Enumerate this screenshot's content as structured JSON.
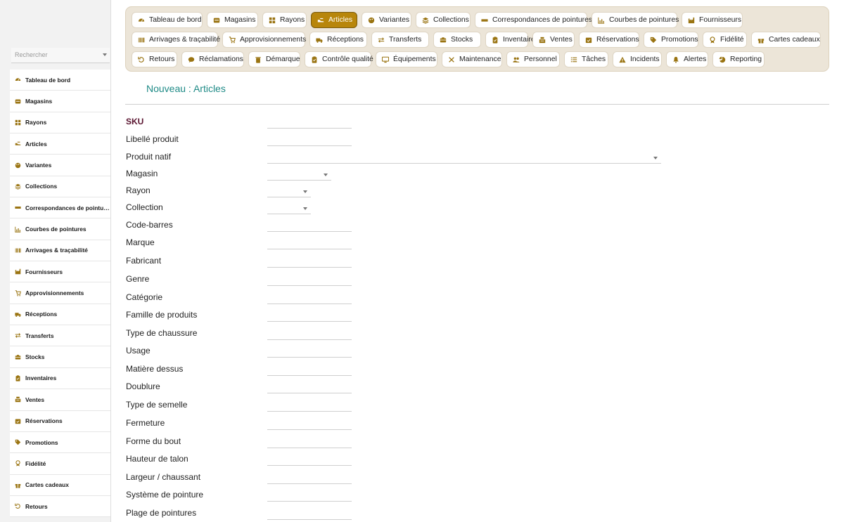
{
  "sidebar": {
    "search_placeholder": "Rechercher",
    "items": [
      {
        "label": "Tableau de bord",
        "icon": "dashboard-icon"
      },
      {
        "label": "Magasins",
        "icon": "store-icon"
      },
      {
        "label": "Rayons",
        "icon": "grid-icon"
      },
      {
        "label": "Articles",
        "icon": "shoe-icon"
      },
      {
        "label": "Variantes",
        "icon": "palette-icon"
      },
      {
        "label": "Collections",
        "icon": "layers-icon"
      },
      {
        "label": "Correspondances de pointures",
        "icon": "ruler-icon"
      },
      {
        "label": "Courbes de pointures",
        "icon": "chart-icon"
      },
      {
        "label": "Arrivages & traçabilité",
        "icon": "barcode-icon"
      },
      {
        "label": "Fournisseurs",
        "icon": "factory-icon"
      },
      {
        "label": "Approvisionnements",
        "icon": "cart-icon"
      },
      {
        "label": "Réceptions",
        "icon": "truck-icon"
      },
      {
        "label": "Transferts",
        "icon": "transfer-icon"
      },
      {
        "label": "Stocks",
        "icon": "box-icon"
      },
      {
        "label": "Inventaires",
        "icon": "clipboard-icon"
      },
      {
        "label": "Ventes",
        "icon": "cash-register-icon"
      },
      {
        "label": "Réservations",
        "icon": "calendar-check-icon"
      },
      {
        "label": "Promotions",
        "icon": "tag-icon"
      },
      {
        "label": "Fidélité",
        "icon": "award-icon"
      },
      {
        "label": "Cartes cadeaux",
        "icon": "gift-icon"
      },
      {
        "label": "Retours",
        "icon": "undo-icon"
      }
    ]
  },
  "topnav": {
    "active": "Articles",
    "rows": [
      [
        {
          "label": "Tableau de bord",
          "icon": "dashboard-icon"
        },
        {
          "label": "Magasins",
          "icon": "store-icon"
        },
        {
          "label": "Rayons",
          "icon": "grid-icon"
        },
        {
          "label": "Articles",
          "icon": "shoe-icon"
        },
        {
          "label": "Variantes",
          "icon": "palette-icon"
        },
        {
          "label": "Collections",
          "icon": "layers-icon"
        },
        {
          "label": "Correspondances de pointures",
          "icon": "ruler-icon"
        },
        {
          "label": "Courbes de pointures",
          "icon": "chart-icon"
        },
        {
          "label": "Fournisseurs",
          "icon": "factory-icon"
        }
      ],
      [
        {
          "label": "Arrivages & traçabilité",
          "icon": "barcode-icon"
        },
        {
          "label": "Approvisionnements",
          "icon": "cart-icon"
        },
        {
          "label": "Réceptions",
          "icon": "truck-icon"
        },
        {
          "label": "Transferts",
          "icon": "transfer-icon"
        },
        {
          "label": "Stocks",
          "icon": "box-icon"
        },
        {
          "label": "Inventaires",
          "icon": "clipboard-icon"
        },
        {
          "label": "Ventes",
          "icon": "cash-register-icon"
        },
        {
          "label": "Réservations",
          "icon": "calendar-check-icon"
        },
        {
          "label": "Promotions",
          "icon": "tag-icon"
        },
        {
          "label": "Fidélité",
          "icon": "award-icon"
        },
        {
          "label": "Cartes cadeaux",
          "icon": "gift-icon"
        }
      ],
      [
        {
          "label": "Retours",
          "icon": "undo-icon"
        },
        {
          "label": "Réclamations",
          "icon": "chat-icon"
        },
        {
          "label": "Démarque",
          "icon": "trash-icon"
        },
        {
          "label": "Contrôle qualité",
          "icon": "clipboard-icon"
        },
        {
          "label": "Équipements",
          "icon": "monitor-icon"
        },
        {
          "label": "Maintenance",
          "icon": "wrench-icon"
        },
        {
          "label": "Personnel",
          "icon": "users-icon"
        },
        {
          "label": "Tâches",
          "icon": "list-icon"
        },
        {
          "label": "Incidents",
          "icon": "warning-icon"
        },
        {
          "label": "Alertes",
          "icon": "bell-icon"
        },
        {
          "label": "Reporting",
          "icon": "pie-chart-icon"
        }
      ]
    ]
  },
  "page": {
    "title": "Nouveau : Articles"
  },
  "form": {
    "fields": [
      {
        "label": "SKU",
        "type": "text",
        "value": "",
        "required": true
      },
      {
        "label": "Libellé produit",
        "type": "text",
        "value": ""
      },
      {
        "label": "Produit natif",
        "type": "select",
        "value": ""
      },
      {
        "label": "Magasin",
        "type": "select",
        "value": ""
      },
      {
        "label": "Rayon",
        "type": "select",
        "value": ""
      },
      {
        "label": "Collection",
        "type": "select",
        "value": ""
      },
      {
        "label": "Code-barres",
        "type": "text",
        "value": ""
      },
      {
        "label": "Marque",
        "type": "text",
        "value": ""
      },
      {
        "label": "Fabricant",
        "type": "text",
        "value": ""
      },
      {
        "label": "Genre",
        "type": "text",
        "value": ""
      },
      {
        "label": "Catégorie",
        "type": "text",
        "value": ""
      },
      {
        "label": "Famille de produits",
        "type": "text",
        "value": ""
      },
      {
        "label": "Type de chaussure",
        "type": "text",
        "value": ""
      },
      {
        "label": "Usage",
        "type": "text",
        "value": ""
      },
      {
        "label": "Matière dessus",
        "type": "text",
        "value": ""
      },
      {
        "label": "Doublure",
        "type": "text",
        "value": ""
      },
      {
        "label": "Type de semelle",
        "type": "text",
        "value": ""
      },
      {
        "label": "Fermeture",
        "type": "text",
        "value": ""
      },
      {
        "label": "Forme du bout",
        "type": "text",
        "value": ""
      },
      {
        "label": "Hauteur de talon",
        "type": "text",
        "value": ""
      },
      {
        "label": "Largeur / chaussant",
        "type": "text",
        "value": ""
      },
      {
        "label": "Système de pointure",
        "type": "text",
        "value": ""
      },
      {
        "label": "Plage de pointures",
        "type": "text",
        "value": ""
      }
    ]
  },
  "colors": {
    "accent": "#b8860b",
    "title": "#1e8a86",
    "required_label": "#5a1530",
    "nav_background": "#ece5d8"
  }
}
